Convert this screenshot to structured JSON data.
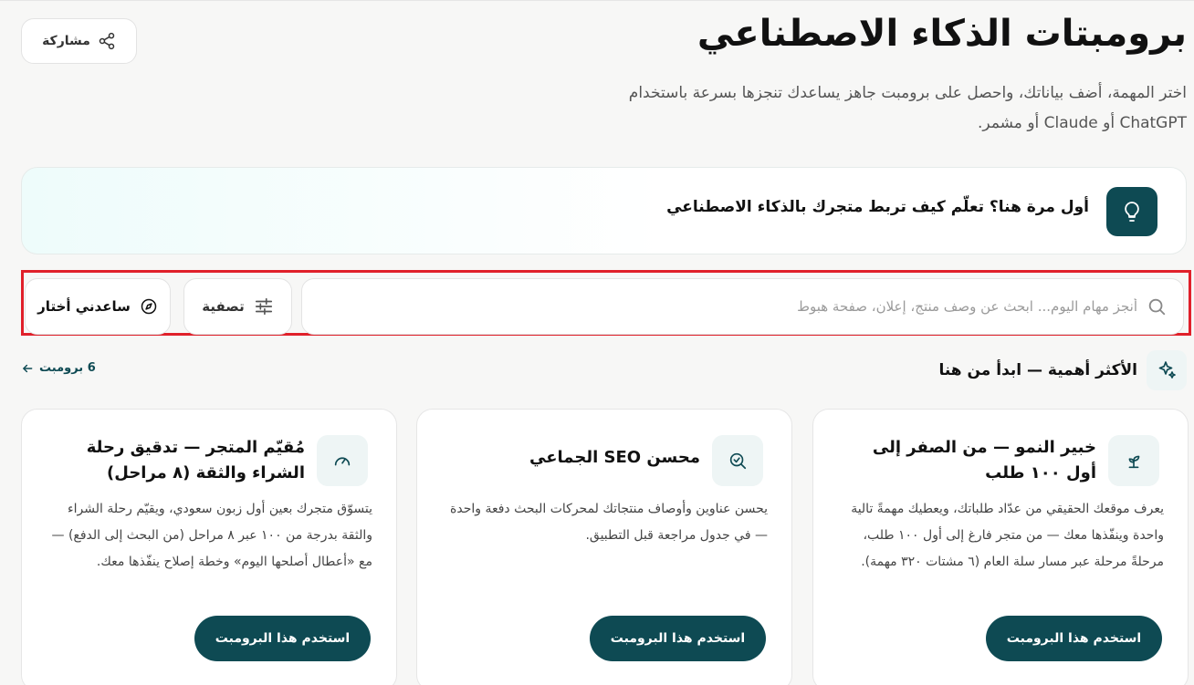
{
  "header": {
    "title": "برومبتات الذكاء الاصطناعي",
    "subtitle": "اختر المهمة، أضف بياناتك، واحصل على برومبت جاهز يساعدك تنجزها بسرعة باستخدام ChatGPT أو Claude أو مشمر.",
    "share_label": "مشاركة"
  },
  "banner": {
    "text": "أول مرة هنا؟ تعلّم كيف تربط متجرك بالذكاء الاصطناعي",
    "icon": "lightbulb-icon"
  },
  "toolbar": {
    "search_placeholder": "أنجز مهام اليوم... ابحث عن وصف منتج، إعلان، صفحة هبوط",
    "search_value": "",
    "filter_label": "تصفية",
    "help_label": "ساعدني أختار"
  },
  "section": {
    "title": "الأكثر أهمية — ابدأ من هنا",
    "count_label": "6 برومبت"
  },
  "cards": [
    {
      "icon": "sprout-icon",
      "title": "خبير النمو — من الصفر إلى أول ١٠٠ طلب",
      "description": "يعرف موقعك الحقيقي من عدّاد طلباتك، ويعطيك مهمةً تالية واحدة وينفّذها معك — من متجر فارغ إلى أول ١٠٠ طلب، مرحلةً مرحلة عبر مسار سلة العام (٦ مشتات ٣٢٠ مهمة).",
      "button_label": "استخدم هذا البرومبت"
    },
    {
      "icon": "search-check-icon",
      "title": "محسن SEO الجماعي",
      "description": "يحسن عناوين وأوصاف منتجاتك لمحركات البحث دفعة واحدة — في جدول مراجعة قبل التطبيق.",
      "button_label": "استخدم هذا البرومبت"
    },
    {
      "icon": "gauge-icon",
      "title": "مُقيّم المتجر — تدقيق رحلة الشراء والثقة (٨ مراحل)",
      "description": "يتسوّق متجرك بعين أول زبون سعودي، ويقيّم رحلة الشراء والثقة بدرجة من ١٠٠ عبر ٨ مراحل (من البحث إلى الدفع) — مع «أعطال أصلحها اليوم» وخطة إصلاح ينفّذها معك.",
      "button_label": "استخدم هذا البرومبت"
    }
  ],
  "colors": {
    "accent": "#0e4a53",
    "highlight_border": "#e0202a"
  }
}
